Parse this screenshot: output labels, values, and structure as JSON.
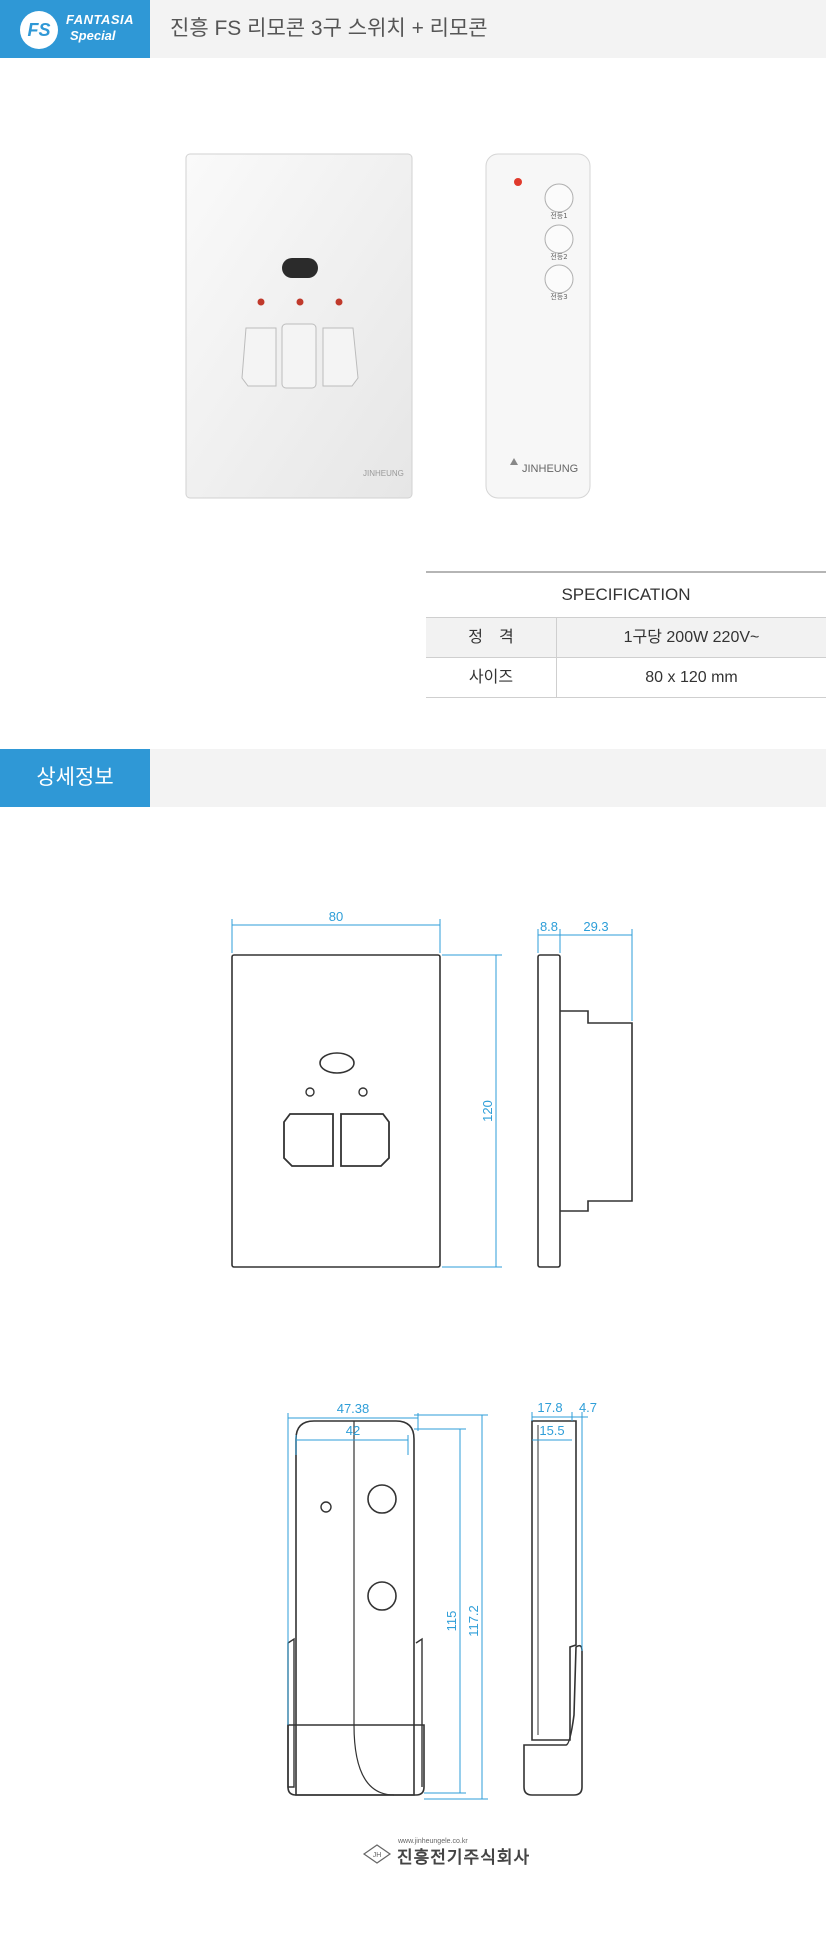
{
  "header": {
    "logo_mark": "FS",
    "logo_line1": "FANTASIA",
    "logo_line2": "Special",
    "title": "진흥 FS 리모콘 3구 스위치 + 리모콘"
  },
  "product": {
    "remote_buttons": [
      "전등1",
      "전등2",
      "전등3"
    ],
    "brand": "JINHEUNG",
    "switch_brand": "JINHEUNG"
  },
  "spec": {
    "heading": "SPECIFICATION",
    "rows": [
      {
        "label": "정　격",
        "value": "1구당 200W 220V~"
      },
      {
        "label": "사이즈",
        "value": "80 x 120 mm"
      }
    ]
  },
  "detail": {
    "tag": "상세정보"
  },
  "drawing1": {
    "width": "80",
    "height": "120",
    "side_thickness": "8.8",
    "side_depth": "29.3"
  },
  "drawing2": {
    "outer_width": "47.38",
    "inner_width": "42",
    "inner_height": "115",
    "outer_height": "117.2",
    "side_total": "17.8",
    "side_inner": "15.5",
    "side_extra": "4.7"
  },
  "footer": {
    "url": "www.jinheungele.co.kr",
    "mark": "JH",
    "company": "진흥전기주식회사"
  },
  "colors": {
    "accent": "#2f98d6",
    "dimension": "#2e9ed8",
    "header_bg": "#f3f3f3"
  }
}
